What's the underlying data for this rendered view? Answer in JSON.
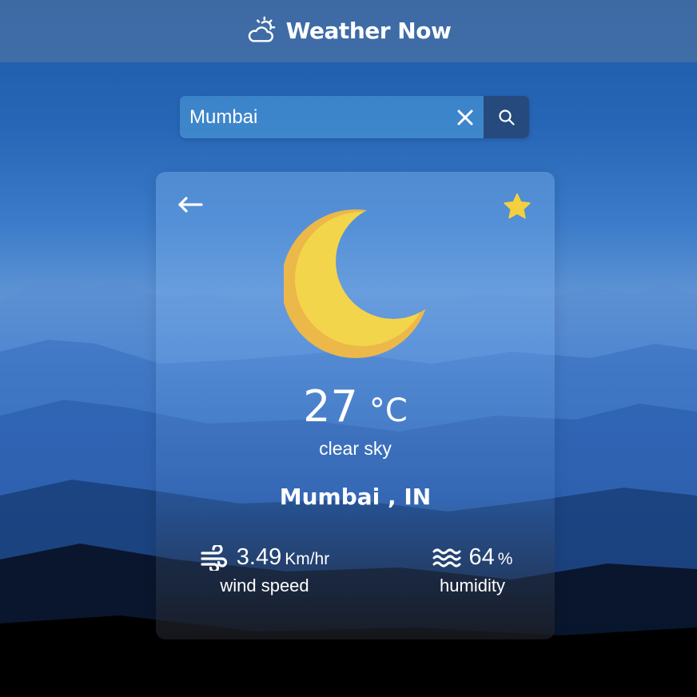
{
  "header": {
    "title": "Weather Now",
    "icon": "cloud-sun-icon"
  },
  "search": {
    "value": "Mumbai",
    "placeholder": "Search city",
    "clear_icon": "close-icon",
    "submit_icon": "search-icon"
  },
  "card": {
    "back_icon": "arrow-left-icon",
    "favorite_icon": "star-icon",
    "favorite_color": "#f4d03f",
    "weather_icon": "crescent-moon-icon",
    "temperature": "27",
    "temperature_unit": "°C",
    "condition": "clear sky",
    "location": "Mumbai , IN",
    "wind": {
      "value": "3.49",
      "unit": "Km/hr",
      "label": "wind speed",
      "icon": "wind-icon"
    },
    "humidity": {
      "value": "64",
      "unit": "%",
      "label": "humidity",
      "icon": "waves-icon"
    }
  },
  "colors": {
    "search_button": "#264a7d",
    "moon_primary": "#f2d54a",
    "moon_shadow": "#ecb84a"
  }
}
